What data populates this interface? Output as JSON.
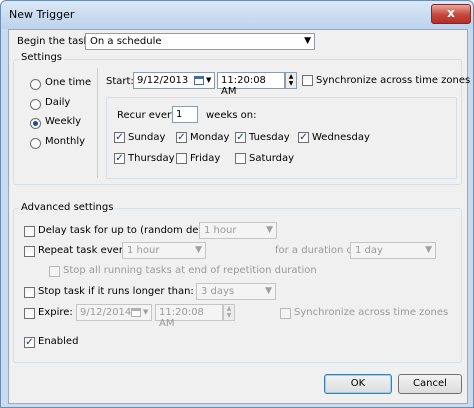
{
  "window": {
    "title": "New Trigger",
    "close_glyph": "x"
  },
  "begin_task": {
    "label": "Begin the task:",
    "value": "On a schedule"
  },
  "settings": {
    "legend": "Settings",
    "frequency_options": [
      {
        "label": "One time",
        "selected": false
      },
      {
        "label": "Daily",
        "selected": false
      },
      {
        "label": "Weekly",
        "selected": true
      },
      {
        "label": "Monthly",
        "selected": false
      }
    ],
    "start": {
      "label": "Start:",
      "date": "9/12/2013",
      "time": "11:20:08 AM"
    },
    "sync_time_zones": {
      "label": "Synchronize across time zones",
      "checked": false
    },
    "recur": {
      "label": "Recur every:",
      "value": "1",
      "suffix": "weeks on:"
    },
    "days": [
      {
        "label": "Sunday",
        "checked": true
      },
      {
        "label": "Monday",
        "checked": true
      },
      {
        "label": "Tuesday",
        "checked": true
      },
      {
        "label": "Wednesday",
        "checked": true
      },
      {
        "label": "Thursday",
        "checked": true
      },
      {
        "label": "Friday",
        "checked": false
      },
      {
        "label": "Saturday",
        "checked": false
      }
    ]
  },
  "advanced": {
    "legend": "Advanced settings",
    "delay": {
      "label": "Delay task for up to (random delay):",
      "value": "1 hour",
      "checked": false
    },
    "repeat": {
      "label": "Repeat task every:",
      "value": "1 hour",
      "checked": false,
      "duration_label": "for a duration of:",
      "duration_value": "1 day"
    },
    "stop_running": {
      "label": "Stop all running tasks at end of repetition duration",
      "checked": false
    },
    "stop_longer": {
      "label": "Stop task if it runs longer than:",
      "value": "3 days",
      "checked": false
    },
    "expire": {
      "label": "Expire:",
      "date": "9/12/2014",
      "time": "11:20:08 AM",
      "checked": false,
      "sync_label": "Synchronize across time zones"
    },
    "enabled": {
      "label": "Enabled",
      "checked": true
    }
  },
  "buttons": {
    "ok": "OK",
    "cancel": "Cancel"
  },
  "icons": {
    "dropdown": "▼",
    "spin_up": "▲",
    "spin_down": "▼",
    "check": "✓"
  }
}
